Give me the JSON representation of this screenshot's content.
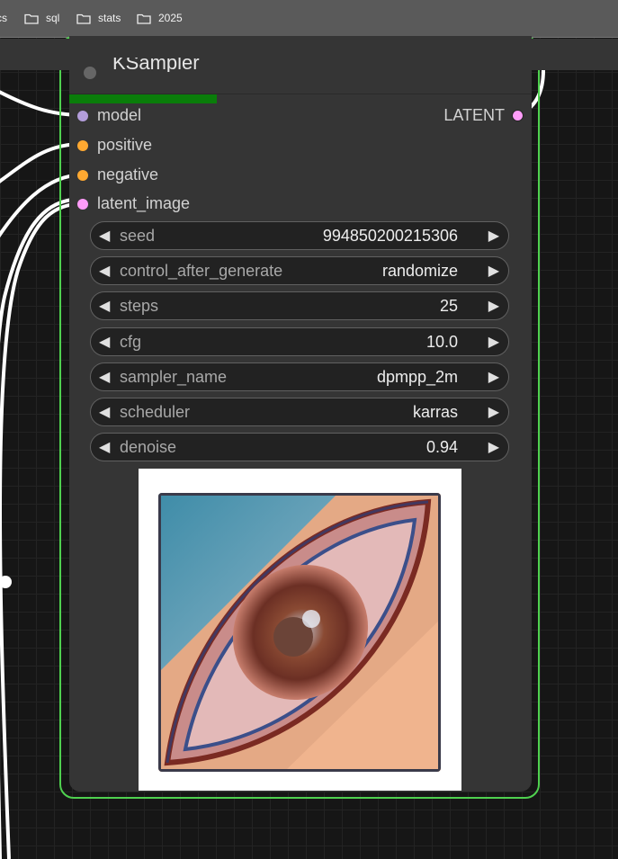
{
  "bookmarks": [
    {
      "label": "cs",
      "icon": "folder-icon"
    },
    {
      "label": "sql",
      "icon": "folder-icon"
    },
    {
      "label": "stats",
      "icon": "folder-icon"
    },
    {
      "label": "2025",
      "icon": "folder-icon"
    }
  ],
  "node": {
    "title": "KSampler",
    "progress": 0.32,
    "inputs": [
      {
        "label": "model",
        "color": "#b39ddb"
      },
      {
        "label": "positive",
        "color": "#ffa931"
      },
      {
        "label": "negative",
        "color": "#ffa931"
      },
      {
        "label": "latent_image",
        "color": "#ff9cf9"
      }
    ],
    "output": {
      "label": "LATENT",
      "color": "#ff9cf9"
    },
    "widgets": [
      {
        "name": "seed",
        "value": "994850200215306"
      },
      {
        "name": "control_after_generate",
        "value": "randomize"
      },
      {
        "name": "steps",
        "value": "25"
      },
      {
        "name": "cfg",
        "value": "10.0"
      },
      {
        "name": "sampler_name",
        "value": "dpmpp_2m"
      },
      {
        "name": "scheduler",
        "value": "karras"
      },
      {
        "name": "denoise",
        "value": "0.94"
      }
    ],
    "arrow_left": "◀",
    "arrow_right": "▶"
  },
  "colors": {
    "node_border": "#4fd14f",
    "progress": "#0a7d0a"
  }
}
